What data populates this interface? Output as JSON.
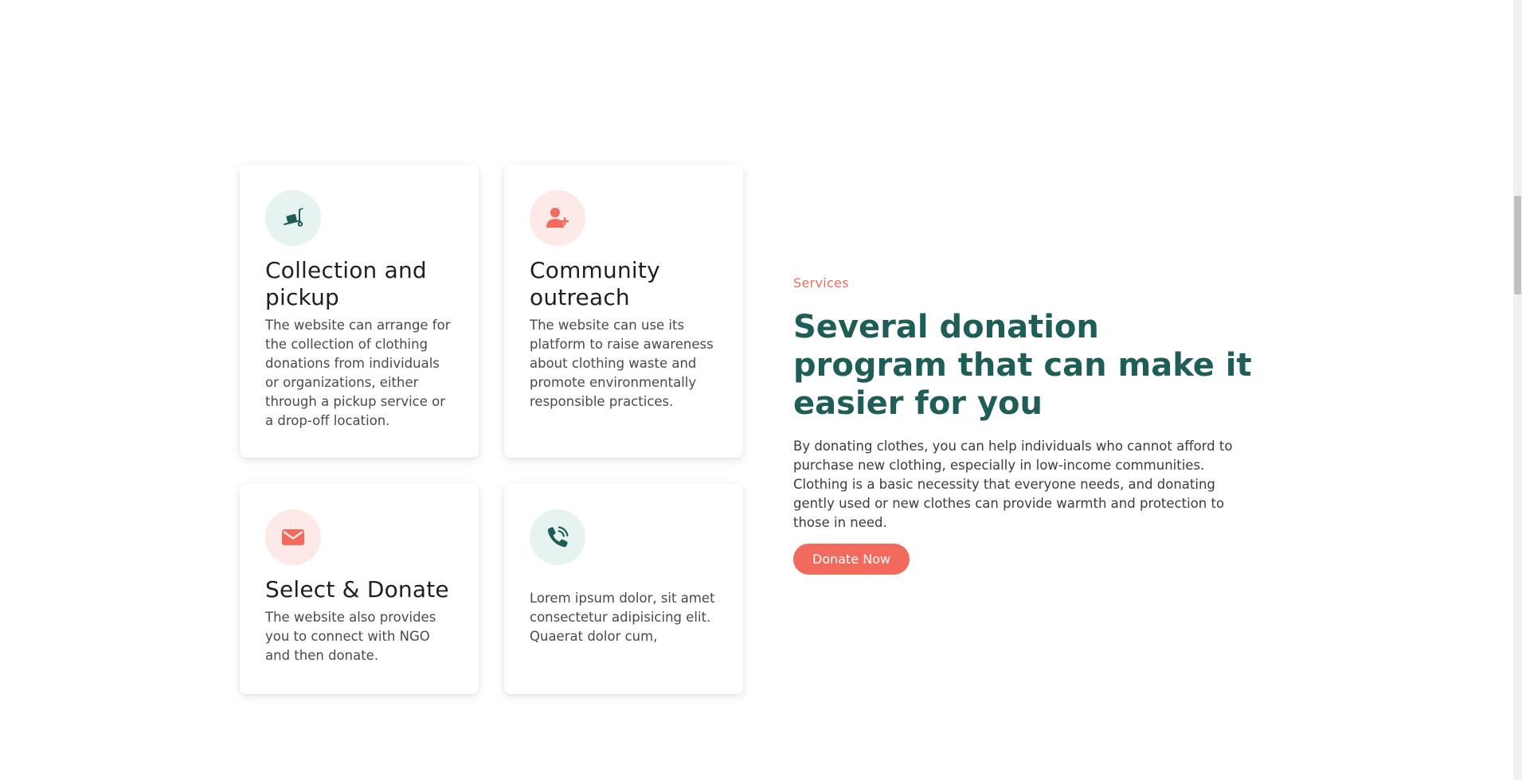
{
  "services": {
    "eyebrow": "Services",
    "headline": "Several donation program that can make it easier for you",
    "description": "By donating clothes, you can help individuals who cannot afford to purchase new clothing, especially in low-income communities. Clothing is a basic necessity that everyone needs, and donating gently used or new clothes can provide warmth and protection to those in need.",
    "cta_label": "Donate Now"
  },
  "cards": [
    {
      "icon": "hand-truck-icon",
      "title": "Collection and pickup",
      "text": "The website can arrange for the collection of clothing donations from individuals or organizations, either through a pickup service or a drop-off location."
    },
    {
      "icon": "user-plus-icon",
      "title": "Community outreach",
      "text": "The website can use its platform to raise awareness about clothing waste and promote environmentally responsible practices."
    },
    {
      "icon": "envelope-icon",
      "title": "Select & Donate",
      "text": "The website also provides you to connect with NGO and then donate."
    },
    {
      "icon": "phone-volume-icon",
      "title": "",
      "text": "Lorem ipsum dolor, sit amet consectetur adipisicing elit. Quaerat dolor cum,"
    }
  ],
  "colors": {
    "accent": "#f26a5e",
    "heading_green": "#1e5e56",
    "icon_bg_green": "#e6f3f0",
    "icon_bg_pink": "#fde9e7"
  }
}
